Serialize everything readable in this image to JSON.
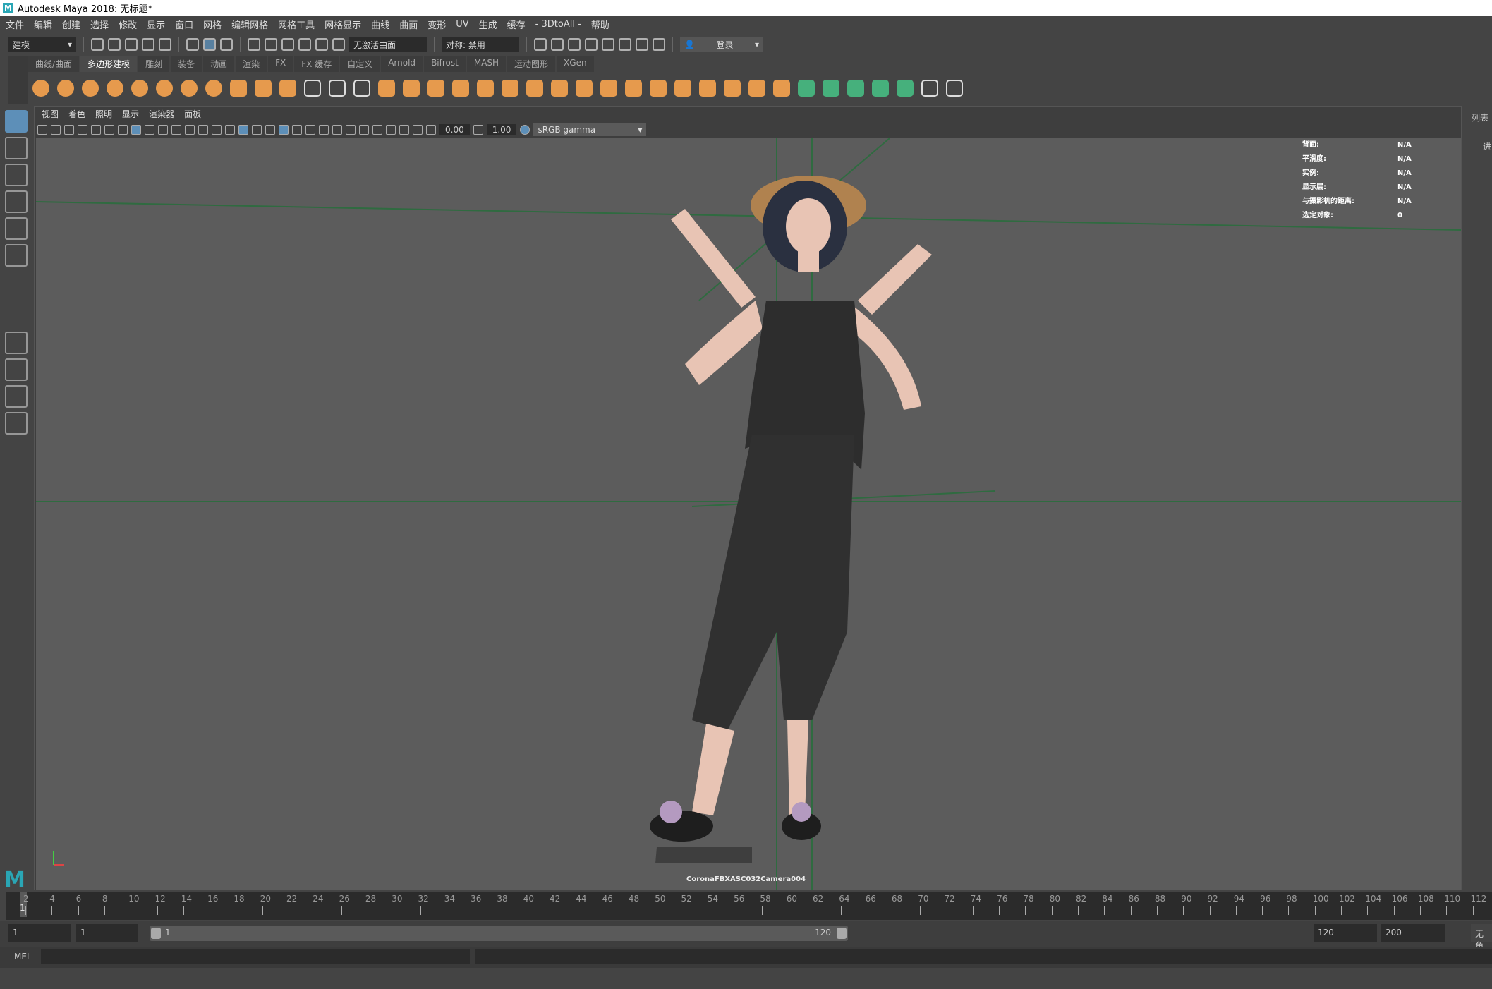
{
  "title": "Autodesk Maya 2018: 无标题*",
  "menu": [
    "文件",
    "编辑",
    "创建",
    "选择",
    "修改",
    "显示",
    "窗口",
    "网格",
    "编辑网格",
    "网格工具",
    "网格显示",
    "曲线",
    "曲面",
    "变形",
    "UV",
    "生成",
    "缓存",
    "- 3DtoAll -",
    "帮助"
  ],
  "status": {
    "mode": "建模",
    "live_surface": "无激活曲面",
    "symmetry": "对称: 禁用",
    "login": "登录"
  },
  "shelf_tabs": [
    "曲线/曲面",
    "多边形建模",
    "雕刻",
    "装备",
    "动画",
    "渲染",
    "FX",
    "FX 缓存",
    "自定义",
    "Arnold",
    "Bifrost",
    "MASH",
    "运动图形",
    "XGen"
  ],
  "shelf_active": 1,
  "shelf_icons": [
    "sphere",
    "cube",
    "cylinder",
    "cone",
    "torus",
    "plane",
    "disc",
    "platonic",
    "super-shape",
    "type",
    "svg",
    "multi-cut",
    "snap-to",
    "freeze",
    "combine",
    "separate",
    "mirror",
    "extract",
    "smooth",
    "bridge",
    "boolean",
    "bevel",
    "extrude",
    "fill-hole",
    "append",
    "target-weld",
    "connect",
    "quad-draw",
    "wedge",
    "mirror-geo",
    "edge-flow",
    "uv-editor",
    "planar-uv",
    "auto-uv",
    "unfold",
    "layout",
    "cut-uv",
    "sew-uv"
  ],
  "panel_menu": [
    "视图",
    "着色",
    "照明",
    "显示",
    "渲染器",
    "面板"
  ],
  "panel_toolbar": {
    "exposure": "0.00",
    "gamma": "1.00",
    "color_space": "sRGB gamma"
  },
  "hud": [
    {
      "label": "背面:",
      "value": "N/A"
    },
    {
      "label": "平滑度:",
      "value": "N/A"
    },
    {
      "label": "实例:",
      "value": "N/A"
    },
    {
      "label": "显示层:",
      "value": "N/A"
    },
    {
      "label": "与摄影机的距离:",
      "value": "N/A"
    },
    {
      "label": "选定对象:",
      "value": "0"
    }
  ],
  "camera": "CoronaFBXASC032Camera004",
  "right_strip": {
    "tab": "列表",
    "item": "进"
  },
  "timeline": {
    "current": "1",
    "labels": [
      "2",
      "4",
      "6",
      "8",
      "10",
      "12",
      "14",
      "16",
      "18",
      "20",
      "22",
      "24",
      "26",
      "28",
      "30",
      "32",
      "34",
      "36",
      "38",
      "40",
      "42",
      "44",
      "46",
      "48",
      "50",
      "52",
      "54",
      "56",
      "58",
      "60",
      "62",
      "64",
      "66",
      "68",
      "70",
      "72",
      "74",
      "76",
      "78",
      "80",
      "82",
      "84",
      "86",
      "88",
      "90",
      "92",
      "94",
      "96",
      "98",
      "100",
      "102",
      "104",
      "106",
      "108",
      "110",
      "112"
    ]
  },
  "range": {
    "start": "1",
    "anim_start": "1",
    "slider_start": "1",
    "slider_end": "120",
    "anim_end": "120",
    "end": "200",
    "char_set": "无角"
  },
  "cmd": {
    "label": "MEL"
  },
  "colors": {
    "accent": "#5d8fb8",
    "shelf": "#e69a4d",
    "grid": "#2f6b40"
  }
}
